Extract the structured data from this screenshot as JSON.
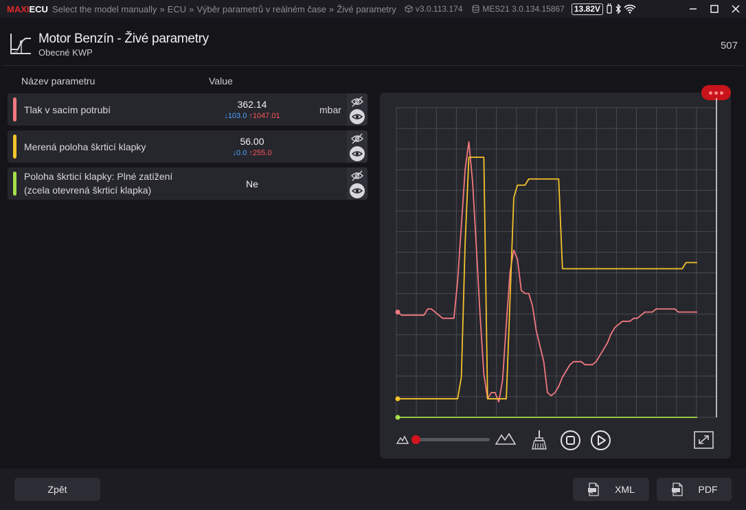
{
  "app": {
    "logo_maxi": "MAXI",
    "logo_ecu": "ECU",
    "breadcrumbs": [
      "Select the model manually",
      "ECU",
      "Výběr parametrů v reálném čase",
      "Živé parametry"
    ],
    "crumb_sep": "»",
    "version": "v3.0.113.174",
    "device": "MES21 3.0.134.15867",
    "voltage": "13.82V"
  },
  "header": {
    "title": "Motor Benzín - Živé parametry",
    "subtitle": "Obecné KWP",
    "count": "507"
  },
  "table": {
    "col_name": "Název parametru",
    "col_value": "Value"
  },
  "params": [
    {
      "name": "Tlak v sacím potrubí",
      "value": "362.14",
      "min": "↓103.0",
      "max": "↑1047.01",
      "unit": "mbar",
      "color": "#f27a7e"
    },
    {
      "name": "Merená poloha škrticí klapky",
      "value": "56.00",
      "min": "↓0.0",
      "max": "↑255.0",
      "unit": "",
      "color": "#f5c42c"
    },
    {
      "name_line1": "Poloha škrticí klapky: Plné zatížení",
      "name_line2": "(zcela otevrená škrticí klapka)",
      "value": "Ne",
      "color": "#a4e04a"
    }
  ],
  "chart_data": {
    "type": "line",
    "x": [
      0,
      1,
      2,
      3,
      4,
      5,
      6,
      7,
      8,
      9,
      10,
      11,
      12,
      13,
      14,
      15,
      16,
      17,
      18,
      19,
      20,
      21,
      22,
      23,
      24,
      25,
      26,
      27,
      28,
      29,
      30,
      31,
      32,
      33,
      34,
      35,
      36,
      37,
      38,
      39,
      40,
      41,
      42,
      43,
      44,
      45,
      46,
      47,
      48,
      49,
      50,
      51,
      52,
      53,
      54,
      55,
      56,
      57,
      58,
      59,
      60,
      61,
      62,
      63,
      64,
      65,
      66,
      67,
      68,
      69,
      70,
      71,
      72,
      73,
      74,
      75,
      76,
      77,
      78,
      79,
      80
    ],
    "series": [
      {
        "color": "#f27a7e",
        "values": [
          0.34,
          0.33,
          0.33,
          0.33,
          0.33,
          0.33,
          0.33,
          0.33,
          0.35,
          0.35,
          0.34,
          0.33,
          0.32,
          0.32,
          0.32,
          0.32,
          0.44,
          0.62,
          0.8,
          0.89,
          0.76,
          0.55,
          0.33,
          0.14,
          0.06,
          0.08,
          0.08,
          0.05,
          0.12,
          0.3,
          0.47,
          0.54,
          0.51,
          0.41,
          0.4,
          0.4,
          0.36,
          0.28,
          0.23,
          0.18,
          0.08,
          0.07,
          0.08,
          0.1,
          0.13,
          0.15,
          0.17,
          0.18,
          0.18,
          0.18,
          0.17,
          0.17,
          0.17,
          0.18,
          0.2,
          0.22,
          0.24,
          0.27,
          0.29,
          0.3,
          0.31,
          0.31,
          0.31,
          0.32,
          0.32,
          0.33,
          0.34,
          0.34,
          0.34,
          0.35,
          0.35,
          0.35,
          0.35,
          0.35,
          0.35,
          0.34,
          0.34,
          0.34,
          0.34,
          0.34,
          0.34
        ]
      },
      {
        "color": "#f5c42c",
        "values": [
          0.06,
          0.06,
          0.06,
          0.06,
          0.06,
          0.06,
          0.06,
          0.06,
          0.06,
          0.06,
          0.06,
          0.06,
          0.06,
          0.06,
          0.06,
          0.06,
          0.06,
          0.13,
          0.56,
          0.84,
          0.84,
          0.84,
          0.84,
          0.84,
          0.06,
          0.06,
          0.06,
          0.06,
          0.06,
          0.06,
          0.38,
          0.71,
          0.75,
          0.75,
          0.75,
          0.77,
          0.77,
          0.77,
          0.77,
          0.77,
          0.77,
          0.77,
          0.77,
          0.77,
          0.48,
          0.48,
          0.48,
          0.48,
          0.48,
          0.48,
          0.48,
          0.48,
          0.48,
          0.48,
          0.48,
          0.48,
          0.48,
          0.48,
          0.48,
          0.48,
          0.48,
          0.48,
          0.48,
          0.48,
          0.48,
          0.48,
          0.48,
          0.48,
          0.48,
          0.48,
          0.48,
          0.48,
          0.48,
          0.48,
          0.48,
          0.48,
          0.48,
          0.5,
          0.5,
          0.5,
          0.5
        ]
      },
      {
        "color": "#a4e04a",
        "values": [
          0.0,
          0.0,
          0.0,
          0.0,
          0.0,
          0.0,
          0.0,
          0.0,
          0.0,
          0.0,
          0.0,
          0.0,
          0.0,
          0.0,
          0.0,
          0.0,
          0.0,
          0.0,
          0.0,
          0.0,
          0.0,
          0.0,
          0.0,
          0.0,
          0.0,
          0.0,
          0.0,
          0.0,
          0.0,
          0.0,
          0.0,
          0.0,
          0.0,
          0.0,
          0.0,
          0.0,
          0.0,
          0.0,
          0.0,
          0.0,
          0.0,
          0.0,
          0.0,
          0.0,
          0.0,
          0.0,
          0.0,
          0.0,
          0.0,
          0.0,
          0.0,
          0.0,
          0.0,
          0.0,
          0.0,
          0.0,
          0.0,
          0.0,
          0.0,
          0.0,
          0.0,
          0.0,
          0.0,
          0.0,
          0.0,
          0.0,
          0.0,
          0.0,
          0.0,
          0.0,
          0.0,
          0.0,
          0.0,
          0.0,
          0.0,
          0.0,
          0.0,
          0.0,
          0.0,
          0.0,
          0.0
        ]
      }
    ],
    "ylim": [
      0,
      1
    ],
    "grid": true
  },
  "chart_controls": {
    "zoom_level": 0.0,
    "icons": [
      "zoom-out-mountain-icon",
      "zoom-in-mountain-icon",
      "clear-broom-icon",
      "stop-icon",
      "play-icon",
      "fullscreen-icon"
    ]
  },
  "footer": {
    "back": "Zpět",
    "xml": "XML",
    "pdf": "PDF"
  }
}
